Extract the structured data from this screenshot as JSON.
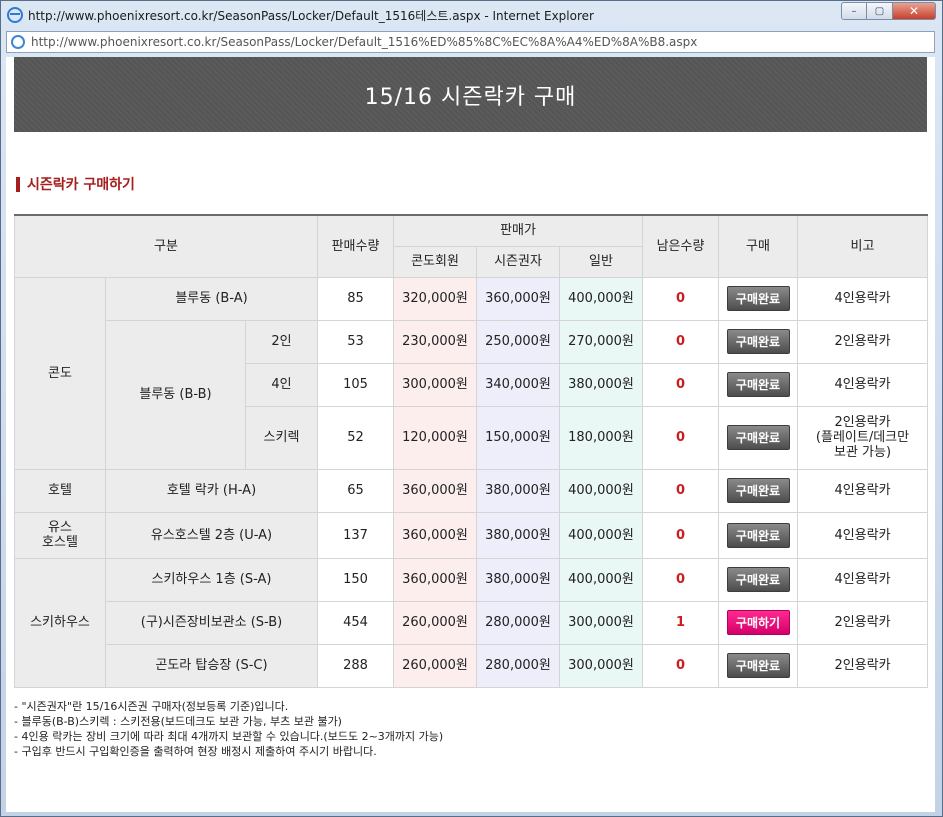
{
  "window": {
    "title": "http://www.phoenixresort.co.kr/SeasonPass/Locker/Default_1516테스트.aspx - Internet Explorer",
    "url": "http://www.phoenixresort.co.kr/SeasonPass/Locker/Default_1516%ED%85%8C%EC%8A%A4%ED%8A%B8.aspx",
    "controls": {
      "minimize": "–",
      "maximize": "▢",
      "close": "✕"
    }
  },
  "banner": {
    "title": "15/16 시즌락카 구매"
  },
  "section": {
    "title": "시즌락카 구매하기"
  },
  "table": {
    "headers": {
      "category": "구분",
      "sales_qty": "판매수량",
      "price_group": "판매가",
      "price_condo": "콘도회원",
      "price_season": "시즌권자",
      "price_general": "일반",
      "remaining": "남은수량",
      "purchase": "구매",
      "remark": "비고"
    },
    "groups": {
      "condo": "콘도",
      "hotel": "호텔",
      "youth": "유스\n호스텔",
      "skihouse": "스키하우스"
    },
    "rows": [
      {
        "name": "블루동 (B-A)",
        "qty": "85",
        "condo": "320,000원",
        "season": "360,000원",
        "general": "400,000원",
        "remaining": "0",
        "button": "구매완료",
        "remark": "4인용락카"
      },
      {
        "name": "블루동 (B-B)",
        "sub": "2인",
        "qty": "53",
        "condo": "230,000원",
        "season": "250,000원",
        "general": "270,000원",
        "remaining": "0",
        "button": "구매완료",
        "remark": "2인용락카"
      },
      {
        "sub": "4인",
        "qty": "105",
        "condo": "300,000원",
        "season": "340,000원",
        "general": "380,000원",
        "remaining": "0",
        "button": "구매완료",
        "remark": "4인용락카"
      },
      {
        "sub": "스키렉",
        "qty": "52",
        "condo": "120,000원",
        "season": "150,000원",
        "general": "180,000원",
        "remaining": "0",
        "button": "구매완료",
        "remark": "2인용락카\n(플레이트/데크만\n보관 가능)"
      },
      {
        "name": "호텔 락카 (H-A)",
        "qty": "65",
        "condo": "360,000원",
        "season": "380,000원",
        "general": "400,000원",
        "remaining": "0",
        "button": "구매완료",
        "remark": "4인용락카"
      },
      {
        "name": "유스호스텔 2층 (U-A)",
        "qty": "137",
        "condo": "360,000원",
        "season": "380,000원",
        "general": "400,000원",
        "remaining": "0",
        "button": "구매완료",
        "remark": "4인용락카"
      },
      {
        "name": "스키하우스 1층 (S-A)",
        "qty": "150",
        "condo": "360,000원",
        "season": "380,000원",
        "general": "400,000원",
        "remaining": "0",
        "button": "구매완료",
        "remark": "4인용락카"
      },
      {
        "name": "(구)시즌장비보관소 (S-B)",
        "qty": "454",
        "condo": "260,000원",
        "season": "280,000원",
        "general": "300,000원",
        "remaining": "1",
        "button": "구매하기",
        "remark": "2인용락카"
      },
      {
        "name": "곤도라 탑승장 (S-C)",
        "qty": "288",
        "condo": "260,000원",
        "season": "280,000원",
        "general": "300,000원",
        "remaining": "0",
        "button": "구매완료",
        "remark": "2인용락카"
      }
    ]
  },
  "notes": [
    "- \"시즌권자\"란 15/16시즌권 구매자(정보등록 기준)입니다.",
    "- 블루동(B-B)스키렉 : 스키전용(보드데크도 보관 가능, 부츠 보관 불가)",
    "- 4인용 락카는 장비 크기에 따라 최대 4개까지 보관할 수 있습니다.(보드도 2~3개까지 가능)",
    "- 구입후 반드시 구입확인증을 출력하여 현장 배정시 제출하여 주시기 바랍니다."
  ]
}
